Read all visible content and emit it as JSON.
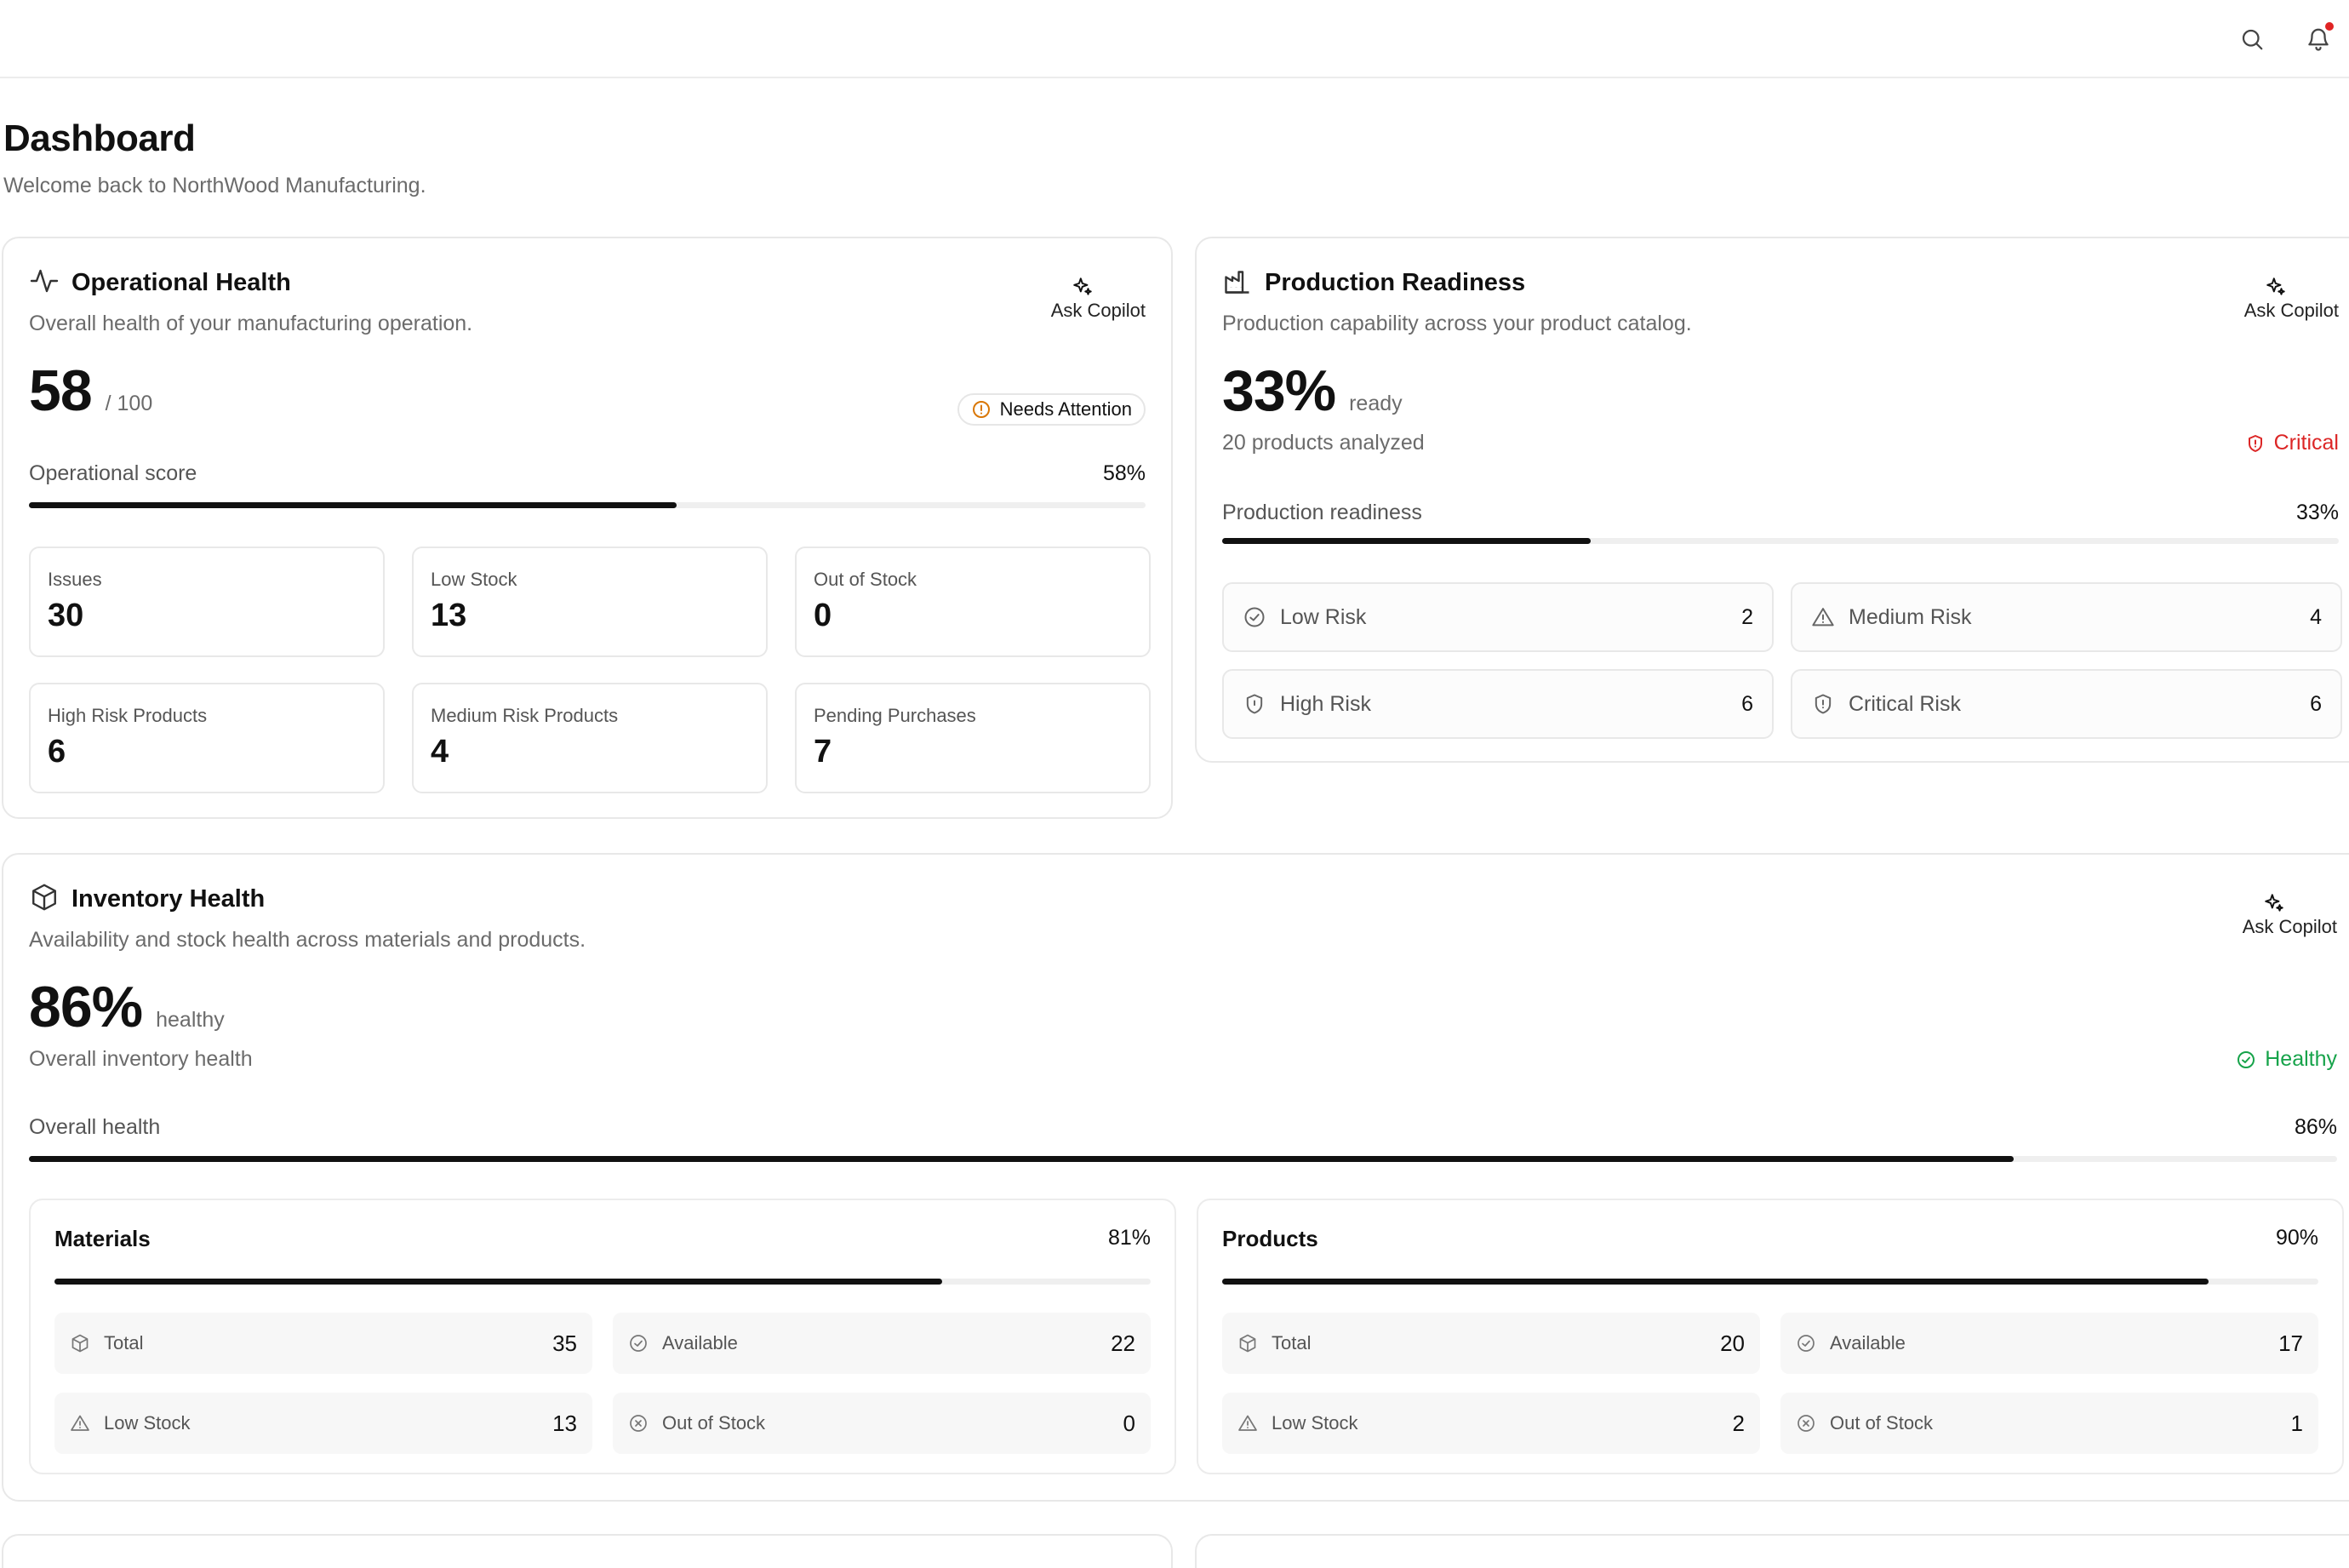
{
  "header": {
    "search_icon": "search-icon",
    "notification_icon": "bell-icon",
    "notification_dot_color": "#e02424"
  },
  "page": {
    "title": "Dashboard",
    "subtitle": "Welcome back to NorthWood Manufacturing."
  },
  "copilot_label": "Ask Copilot",
  "operational": {
    "title": "Operational Health",
    "description": "Overall health of your manufacturing operation.",
    "score": "58",
    "score_max": "/ 100",
    "status": "Needs Attention",
    "status_color": "#d97706",
    "bar_label": "Operational score",
    "bar_pct": "58%",
    "bar_value": 58,
    "stats": [
      {
        "label": "Issues",
        "value": "30"
      },
      {
        "label": "Low Stock",
        "value": "13"
      },
      {
        "label": "Out of Stock",
        "value": "0"
      },
      {
        "label": "High Risk Products",
        "value": "6"
      },
      {
        "label": "Medium Risk Products",
        "value": "4"
      },
      {
        "label": "Pending Purchases",
        "value": "7"
      }
    ]
  },
  "production": {
    "title": "Production Readiness",
    "description": "Production capability across your product catalog.",
    "score": "33%",
    "score_unit": "ready",
    "analyzed": "20 products analyzed",
    "status": "Critical",
    "status_color": "#dc2626",
    "bar_label": "Production readiness",
    "bar_pct": "33%",
    "bar_value": 33,
    "risks": [
      {
        "label": "Low Risk",
        "value": "2",
        "icon": "check-circle-icon"
      },
      {
        "label": "Medium Risk",
        "value": "4",
        "icon": "warning-triangle-icon"
      },
      {
        "label": "High Risk",
        "value": "6",
        "icon": "shield-icon"
      },
      {
        "label": "Critical Risk",
        "value": "6",
        "icon": "shield-alert-icon"
      }
    ]
  },
  "inventory": {
    "title": "Inventory Health",
    "description": "Availability and stock health across materials and products.",
    "score": "86%",
    "score_unit": "healthy",
    "overall_label": "Overall inventory health",
    "status": "Healthy",
    "status_color": "#16a34a",
    "bar_label": "Overall health",
    "bar_pct": "86%",
    "bar_value": 86,
    "materials": {
      "title": "Materials",
      "pct": "81%",
      "bar_value": 81,
      "items": [
        {
          "label": "Total",
          "value": "35"
        },
        {
          "label": "Available",
          "value": "22"
        },
        {
          "label": "Low Stock",
          "value": "13"
        },
        {
          "label": "Out of Stock",
          "value": "0"
        }
      ]
    },
    "products": {
      "title": "Products",
      "pct": "90%",
      "bar_value": 90,
      "items": [
        {
          "label": "Total",
          "value": "20"
        },
        {
          "label": "Available",
          "value": "17"
        },
        {
          "label": "Low Stock",
          "value": "2"
        },
        {
          "label": "Out of Stock",
          "value": "1"
        }
      ]
    }
  }
}
